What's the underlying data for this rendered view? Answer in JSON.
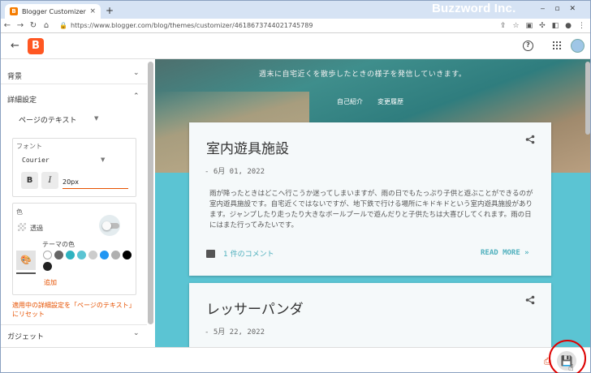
{
  "browser": {
    "tab_title": "Blogger Customizer",
    "tab_close": "×",
    "new_tab": "+",
    "brand": "Buzzword Inc.",
    "url": "https://www.blogger.com/blog/themes/customizer/4618673744021745789"
  },
  "header": {
    "logo_letter": "B",
    "help": "?"
  },
  "panel": {
    "background_label": "背景",
    "advanced_label": "詳細設定",
    "selected_option": "ページのテキスト",
    "font_section": {
      "title": "フォント",
      "font_name": "Courier",
      "bold_label": "B",
      "italic_label": "I",
      "size_value": "20px"
    },
    "color_section": {
      "title": "色",
      "transparent_label": "透過",
      "theme_colors_label": "テーマの色",
      "add_label": "追加",
      "swatches": [
        "#ffffff",
        "#666666",
        "#2fb3c0",
        "#5bc4d3",
        "#cccccc",
        "#2196f3",
        "#b0b0b0",
        "#000000",
        "#222222"
      ]
    },
    "reset_hint": "適用中の詳細設定を「ページのテキスト」にリセット",
    "gadget_label": "ガジェット"
  },
  "preview": {
    "tagline": "週末に自宅近くを散歩したときの様子を発信していきます。",
    "nav": [
      "自己紹介",
      "変更履歴"
    ],
    "posts": [
      {
        "title": "室内遊具施設",
        "date": "- 6月 01, 2022",
        "body": "雨が降ったときはどこへ行こうか迷ってしまいますが、雨の日でもたっぷり子供と遊ぶことができるのが室内遊具施設です。自宅近くではないですが、地下鉄で行ける場所にキドキドという室内遊具施設があります。ジャンプしたり走ったり大きなボールプールで遊んだりと子供たちは大喜びしてくれます。雨の日にはまた行ってみたいです。",
        "comments": "1 件のコメント",
        "read_more": "READ MORE »"
      },
      {
        "title": "レッサーパンダ",
        "date": "- 5月 22, 2022"
      }
    ]
  }
}
